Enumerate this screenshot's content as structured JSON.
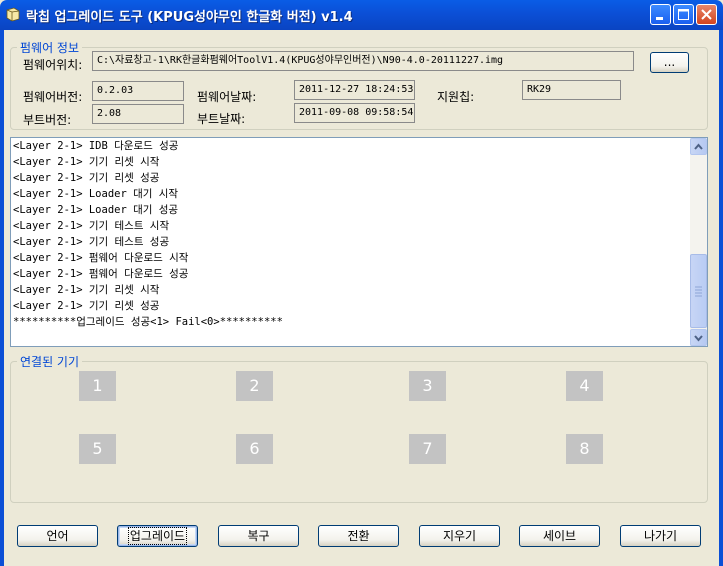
{
  "window": {
    "title": "락칩 업그레이드 도구 (KPUG성야무인 한글화 버전) v1.4",
    "icon": "app-icon"
  },
  "firmware_info": {
    "legend": "펌웨어 정보",
    "location_label": "펌웨어위치:",
    "location_value": "C:\\자료창고-1\\RK한글화펌웨어ToolV1.4(KPUG성야무인버전)\\N90-4.0-20111227.img",
    "browse_label": "...",
    "fw_version_label": "펌웨어버전:",
    "fw_version_value": "0.2.03",
    "fw_date_label": "펌웨어날짜:",
    "fw_date_value": "2011-12-27  18:24:53",
    "chip_label": "지원칩:",
    "chip_value": "RK29",
    "boot_version_label": "부트버전:",
    "boot_version_value": "2.08",
    "boot_date_label": "부트날짜:",
    "boot_date_value": "2011-09-08  09:58:54"
  },
  "log": {
    "lines": [
      "<Layer 2-1> IDB 다운로드 성공",
      "<Layer 2-1> 기기 리셋 시작",
      "<Layer 2-1> 기기 리셋 성공",
      "<Layer 2-1> Loader 대기 시작",
      "<Layer 2-1> Loader 대기 성공",
      "<Layer 2-1> 기기 테스트 시작",
      "<Layer 2-1> 기기 테스트 성공",
      "<Layer 2-1> 펌웨어 다운로드 시작",
      "<Layer 2-1> 펌웨어 다운로드 성공",
      "<Layer 2-1> 기기 리셋 시작",
      "<Layer 2-1> 기기 리셋 성공",
      "**********업그레이드 성공<1> Fail<0>**********"
    ]
  },
  "devices": {
    "legend": "연결된 기기",
    "slots": [
      "1",
      "2",
      "3",
      "4",
      "5",
      "6",
      "7",
      "8"
    ],
    "slot_color": "#c3c3c3"
  },
  "buttons": {
    "language": "언어",
    "upgrade": "업그레이드",
    "restore": "복구",
    "switch": "전환",
    "erase": "지우기",
    "save": "세이브",
    "exit": "나가기"
  },
  "colors": {
    "titlebar": "#0b4fd6",
    "legend_text": "#0046d5",
    "dialog_bg": "#ece9d8"
  }
}
